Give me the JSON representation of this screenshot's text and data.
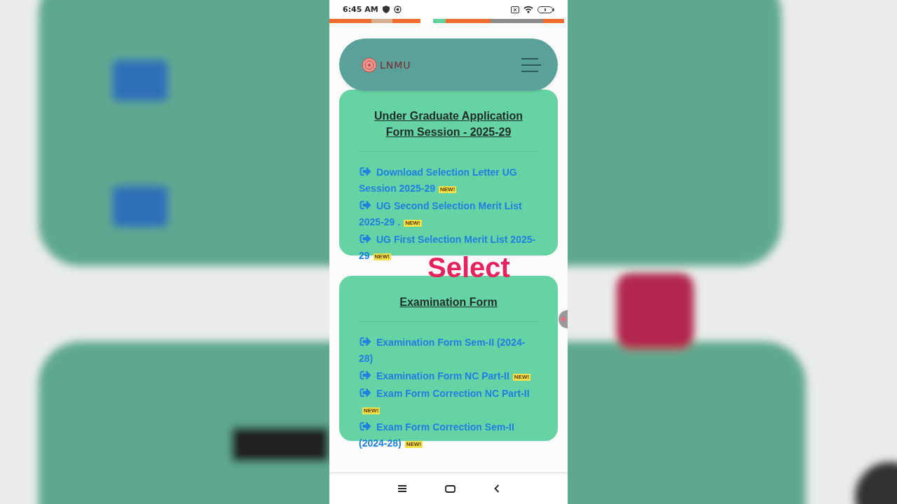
{
  "status_bar": {
    "time": "6:45 AM"
  },
  "header": {
    "logo": "LNMU"
  },
  "sections": [
    {
      "title": "Under Graduate Application Form Session - 2025-29",
      "links": [
        {
          "text": "Download Selection Letter UG Session 2025-29",
          "badge": "NEW!"
        },
        {
          "text": "UG Second Selection Merit List 2025-29 .",
          "badge": "NEW!"
        },
        {
          "text": "UG First Selection Merit List 2025-29",
          "badge": "NEW!"
        }
      ]
    },
    {
      "title": "Examination Form",
      "links": [
        {
          "text": "Examination Form Sem-II (2024-28)"
        },
        {
          "text": "Examination Form NC Part-II",
          "badge": "NEW!"
        },
        {
          "text": "Exam Form Correction NC Part-II",
          "badge": "NEW!"
        },
        {
          "text": "Exam Form Correction Sem-II (2024-28)",
          "badge": "NEW!"
        }
      ]
    }
  ],
  "caption": "Select"
}
